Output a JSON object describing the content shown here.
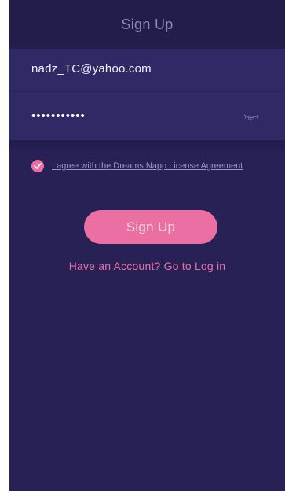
{
  "header": {
    "title": "Sign Up"
  },
  "form": {
    "email_value": "nadz_TC@yahoo.com",
    "password_value": "•••••••••••",
    "eye_icon": "closed-eye-icon"
  },
  "agreement": {
    "checked": true,
    "check_icon": "checkmark-icon",
    "label": "I agree with the Dreams Napp License Agreement"
  },
  "actions": {
    "signup_label": "Sign Up",
    "login_link": "Have an Account? Go to Log in"
  },
  "colors": {
    "background": "#272156",
    "header": "#221d4b",
    "field_panel": "#2f2965",
    "accent": "#ec6fa4",
    "muted_text": "#9c96c4"
  }
}
